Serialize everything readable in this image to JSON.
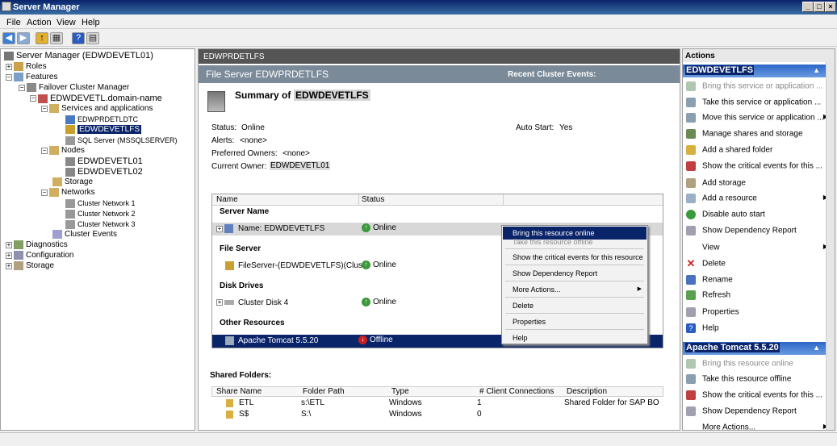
{
  "window": {
    "title": "Server Manager"
  },
  "menu": [
    "File",
    "Action",
    "View",
    "Help"
  ],
  "tree": {
    "root": "Server Manager (EDWDEVETL01)",
    "roles": "Roles",
    "features": "Features",
    "fcm": "Failover Cluster Manager",
    "cluster": "EDWDEVETL.domain-name",
    "services": "Services and applications",
    "svc1": "EDWPRDETLDTC",
    "svc2": "EDWDEVETLFS",
    "svc3": "SQL Server (MSSQLSERVER)",
    "nodes": "Nodes",
    "node1": "EDWDEVETL01",
    "node2": "EDWDEVETL02",
    "storage": "Storage",
    "networks": "Networks",
    "net1": "Cluster Network 1",
    "net2": "Cluster Network 2",
    "net3": "Cluster Network 3",
    "events": "Cluster Events",
    "diagnostics": "Diagnostics",
    "configuration": "Configuration",
    "storage2": "Storage"
  },
  "center": {
    "header": "EDWPRDETLFS",
    "fs_title": "File Server EDWPRDETLFS",
    "recent_events": "Recent Cluster Events:",
    "summary_prefix": "Summary of",
    "summary_name": "EDWDEVETLFS",
    "status_label": "Status:",
    "status_value": "Online",
    "alerts_label": "Alerts:",
    "alerts_value": "<none>",
    "pref_label": "Preferred Owners:",
    "pref_value": "<none>",
    "owner_label": "Current Owner:",
    "owner_value": "EDWDEVETL01",
    "autostart_label": "Auto Start:",
    "autostart_value": "Yes",
    "col_name": "Name",
    "col_status": "Status",
    "grp_server": "Server Name",
    "r1_name": "Name: EDWDEVETLFS",
    "r1_status": "Online",
    "grp_file": "File Server",
    "r2_name": "FileServer-(EDWDEVETLFS)(Clust",
    "r2_status": "Online",
    "grp_disk": "Disk Drives",
    "r3_name": "Cluster Disk 4",
    "r3_status": "Online",
    "grp_other": "Other Resources",
    "r4_name": "Apache Tomcat 5.5.20",
    "r4_status": "Offline",
    "shared_title": "Shared Folders:",
    "sh_cols": [
      "Share Name",
      "Folder Path",
      "Type",
      "# Client Connections",
      "Description"
    ],
    "shares": [
      {
        "name": "ETL",
        "path": "s:\\ETL",
        "type": "Windows",
        "conn": "1",
        "desc": "Shared Folder for SAP BO"
      },
      {
        "name": "S$",
        "path": "S:\\",
        "type": "Windows",
        "conn": "0",
        "desc": ""
      }
    ]
  },
  "context_menu": {
    "bring_online": "Bring this resource online",
    "take_offline": "Take this resource offline",
    "critical": "Show the critical events for this resource",
    "dependency": "Show Dependency Report",
    "more": "More Actions...",
    "delete": "Delete",
    "properties": "Properties",
    "help": "Help"
  },
  "actions": {
    "title": "Actions",
    "sec1": "EDWDEVETLFS",
    "a1": "Bring this service or application ...",
    "a2": "Take this service or application ...",
    "a3": "Move this service or application ...",
    "a4": "Manage shares and storage",
    "a5": "Add a shared folder",
    "a6": "Show the critical events for this ...",
    "a7": "Add storage",
    "a8": "Add a resource",
    "a9": "Disable auto start",
    "a10": "Show Dependency Report",
    "a11": "View",
    "a12": "Delete",
    "a13": "Rename",
    "a14": "Refresh",
    "a15": "Properties",
    "a16": "Help",
    "sec2": "Apache Tomcat 5.5.20",
    "b1": "Bring this resource online",
    "b2": "Take this resource offline",
    "b3": "Show the critical events for this ...",
    "b4": "Show Dependency Report",
    "b5": "More Actions..."
  },
  "colors": {
    "selection": "#0a246a",
    "header_gray": "#555555",
    "accent_blue": "#2b66c8"
  }
}
